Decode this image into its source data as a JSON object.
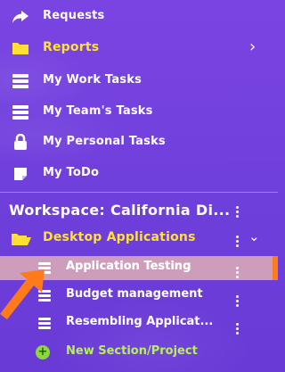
{
  "menu": {
    "items": [
      {
        "label": "Requests",
        "icon": "share-arrow-icon"
      },
      {
        "label": "Reports",
        "icon": "folder-icon"
      },
      {
        "label": "My Work Tasks",
        "icon": "list-icon"
      },
      {
        "label": "My Team's Tasks",
        "icon": "list-icon"
      },
      {
        "label": "My Personal Tasks",
        "icon": "lock-icon"
      },
      {
        "label": "My ToDo",
        "icon": "note-icon"
      }
    ],
    "reports_chevron": "›"
  },
  "workspace": {
    "title": "Workspace: California Di..."
  },
  "project": {
    "label": "Desktop Applications",
    "chevron": "⌄"
  },
  "sections": [
    {
      "label": "Application Testing",
      "selected": true
    },
    {
      "label": "Budget management",
      "selected": false
    },
    {
      "label": "Resembling Applicat...",
      "selected": false
    }
  ],
  "new_section": {
    "label": "New Section/Project",
    "plus": "+"
  },
  "colors": {
    "background": "#7a44e2",
    "yellow": "#ffe033",
    "green": "#b8f05a",
    "highlight": "#e9b9b2",
    "accent": "#ff7a1a"
  }
}
